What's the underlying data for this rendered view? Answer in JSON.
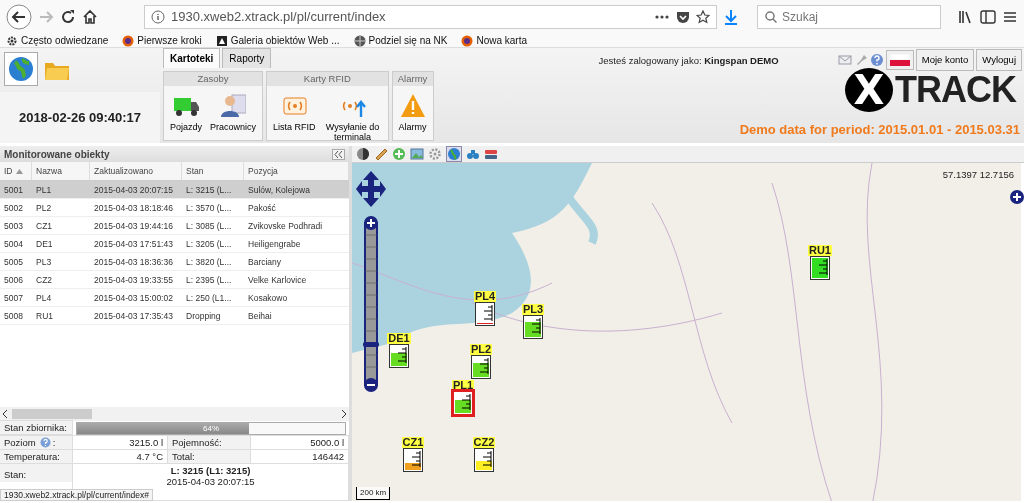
{
  "browser": {
    "url": "1930.xweb2.xtrack.pl/pl/current/index",
    "search_placeholder": "Szukaj",
    "bookmarks": [
      {
        "label": "Często odwiedzane",
        "kind": "gear"
      },
      {
        "label": "Pierwsze kroki",
        "kind": "firefox"
      },
      {
        "label": "Galeria obiektów Web ...",
        "kind": "gallery"
      },
      {
        "label": "Podziel się na NK",
        "kind": "globe"
      },
      {
        "label": "Nowa karta",
        "kind": "firefox"
      }
    ]
  },
  "header": {
    "datetime": "2018-02-26 09:40:17",
    "tabs": [
      {
        "label": "Kartoteki",
        "selected": true
      },
      {
        "label": "Raporty",
        "selected": false
      }
    ],
    "ribbon_groups": [
      {
        "title": "Zasoby",
        "items": [
          {
            "label": "Pojazdy",
            "kind": "truck"
          },
          {
            "label": "Pracownicy",
            "kind": "person"
          }
        ]
      },
      {
        "title": "Karty RFID",
        "items": [
          {
            "label": "Lista RFID",
            "kind": "rfid"
          },
          {
            "label": "Wysyłanie do terminala",
            "kind": "rfid-upload"
          }
        ]
      },
      {
        "title": "Alarmy",
        "items": [
          {
            "label": "Alarmy",
            "kind": "warning"
          }
        ]
      }
    ],
    "login": "Jesteś zalogowany jako: **Kingspan DEMO**",
    "account_buttons": [
      "Moje konto",
      "Wyloguj"
    ],
    "logo": {
      "mark": "X",
      "text": "TRACK"
    },
    "demo_notice": "Demo data for period: 2015.01.01 - 2015.03.31"
  },
  "objects_panel": {
    "title": "Monitorowane obiekty",
    "columns": [
      {
        "label": "ID",
        "sorted": true
      },
      {
        "label": "Nazwa",
        "sorted": false
      },
      {
        "label": "Zaktualizowano",
        "sorted": false
      },
      {
        "label": "Stan",
        "sorted": false
      },
      {
        "label": "Pozycja",
        "sorted": false
      }
    ],
    "rows": [
      {
        "cells": [
          "5001",
          "PL1",
          "2015-04-03 20:07:15",
          "L: 3215 (L...",
          "Sulów, Kolejowa"
        ],
        "selected": true
      },
      {
        "cells": [
          "5002",
          "PL2",
          "2015-04-03 18:18:46",
          "L: 3570 (L...",
          "Pakość"
        ],
        "selected": false
      },
      {
        "cells": [
          "5003",
          "CZ1",
          "2015-04-03 19:44:16",
          "L: 3085 (L...",
          "Zvikovske Podhradi"
        ],
        "selected": false
      },
      {
        "cells": [
          "5004",
          "DE1",
          "2015-04-03 17:51:43",
          "L: 3205 (L...",
          "Heiligengrabe"
        ],
        "selected": false
      },
      {
        "cells": [
          "5005",
          "PL3",
          "2015-04-03 18:36:36",
          "L: 3820 (L...",
          "Barciany"
        ],
        "selected": false
      },
      {
        "cells": [
          "5006",
          "CZ2",
          "2015-04-03 19:33:55",
          "L: 2395 (L...",
          "Velke Karlovice"
        ],
        "selected": false
      },
      {
        "cells": [
          "5007",
          "PL4",
          "2015-04-03 15:00:02",
          "L: 250 (L1...",
          "Kosakowo"
        ],
        "selected": false
      },
      {
        "cells": [
          "5008",
          "RU1",
          "2015-04-03 17:35:43",
          "Dropping",
          "Beihai"
        ],
        "selected": false
      }
    ]
  },
  "tank": {
    "label": "Stan zbiornika:",
    "level": 0.64,
    "reading": "64%"
  },
  "detail_rows": [
    {
      "label": "Poziom",
      "help": true,
      "colon": ":",
      "value": "3215.0 l",
      "label2": "Pojemność:",
      "value2": "5000.0 l"
    },
    {
      "label": "Temperatura:",
      "help": false,
      "value": "4.7 °C",
      "label2": "Total:",
      "value2": "146442"
    }
  ],
  "status_row": {
    "label": "Stan:",
    "lines": [
      "L: 3215 (L1: 3215)",
      "2015-04-03 20:07:15"
    ]
  },
  "map": {
    "coords": "57.1397 12.7156",
    "scale": "200 km",
    "markers": [
      {
        "label": "RU1",
        "level": 1.0,
        "color": "#33dd22",
        "selected": false
      },
      {
        "label": "PL4",
        "level": 0.05,
        "color": "#e02020",
        "selected": false
      },
      {
        "label": "PL3",
        "level": 0.75,
        "color": "#66dd22",
        "selected": false
      },
      {
        "label": "DE1",
        "level": 0.64,
        "color": "#66dd22",
        "selected": false
      },
      {
        "label": "PL2",
        "level": 0.7,
        "color": "#66dd22",
        "selected": false
      },
      {
        "label": "PL1",
        "level": 0.64,
        "color": "#66dd22",
        "selected": true
      },
      {
        "label": "CZ1",
        "level": 0.35,
        "color": "#f0a020",
        "selected": false
      },
      {
        "label": "CZ2",
        "level": 0.45,
        "color": "#ffee22",
        "selected": false
      }
    ]
  },
  "status_url": "1930.xweb2.xtrack.pl/pl/current/index#"
}
